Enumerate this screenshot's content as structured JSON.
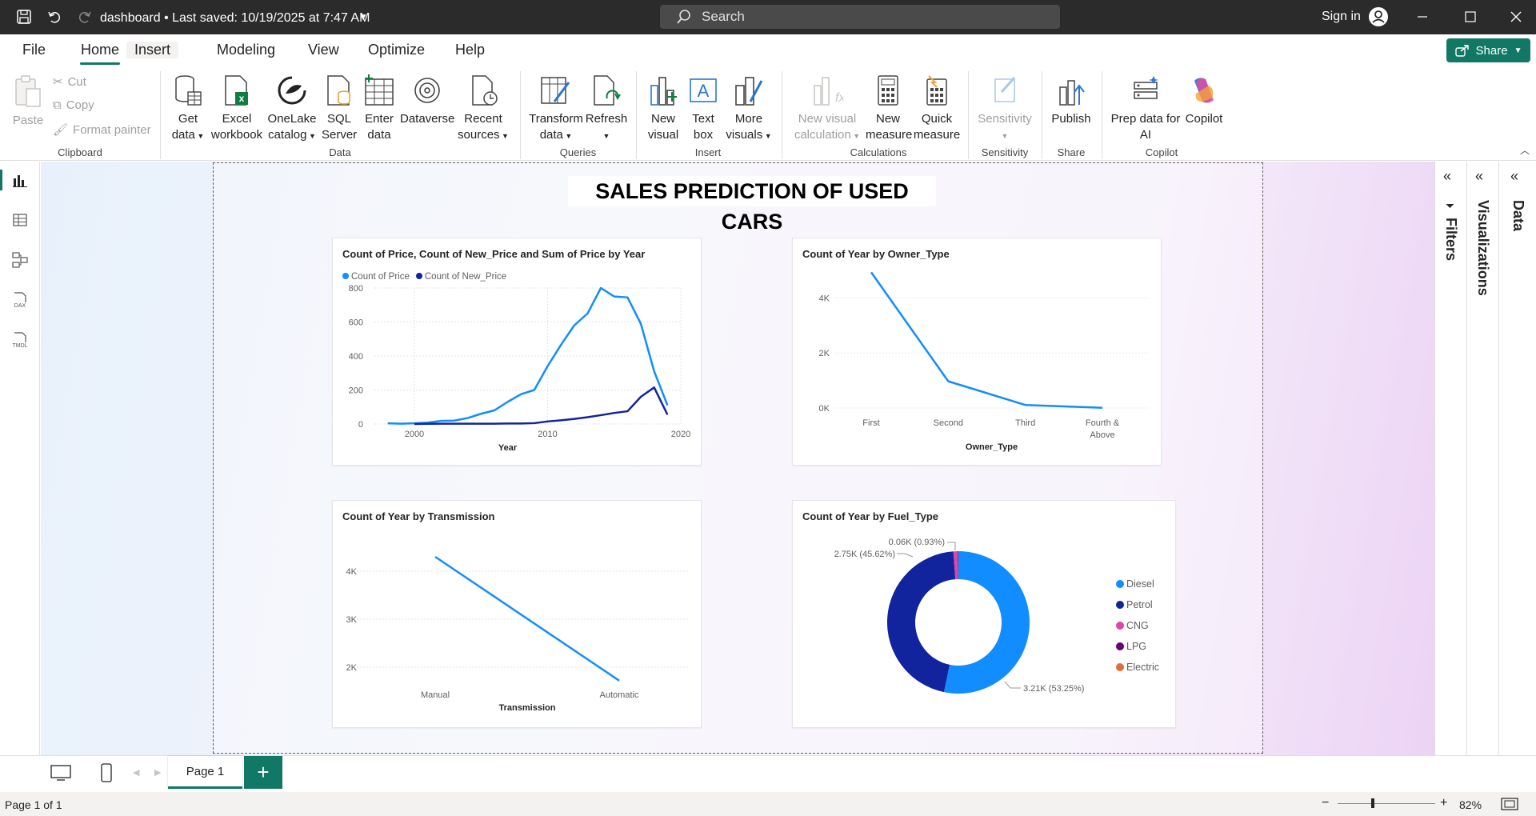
{
  "titlebar": {
    "title": "dashboard • Last saved: 10/19/2025 at 7:47 AM",
    "search_placeholder": "Search",
    "signin": "Sign in"
  },
  "menu": {
    "items": [
      "File",
      "Home",
      "Insert",
      "Modeling",
      "View",
      "Optimize",
      "Help"
    ],
    "active": "Home",
    "share": "Share"
  },
  "ribbon": {
    "clipboard": {
      "paste": "Paste",
      "cut": "Cut",
      "copy": "Copy",
      "format_painter": "Format painter",
      "label": "Clipboard"
    },
    "data": {
      "get_data": [
        "Get",
        "data"
      ],
      "excel": [
        "Excel",
        "workbook"
      ],
      "onelake": [
        "OneLake",
        "catalog"
      ],
      "sql": [
        "SQL",
        "Server"
      ],
      "enter": [
        "Enter",
        "data"
      ],
      "dataverse": [
        "Dataverse",
        ""
      ],
      "recent": [
        "Recent",
        "sources"
      ],
      "label": "Data"
    },
    "queries": {
      "transform": [
        "Transform",
        "data"
      ],
      "refresh": [
        "Refresh",
        ""
      ],
      "label": "Queries"
    },
    "insert": {
      "new_visual": [
        "New",
        "visual"
      ],
      "text_box": [
        "Text",
        "box"
      ],
      "more_visuals": [
        "More",
        "visuals"
      ],
      "label": "Insert"
    },
    "calculations": {
      "new_visual_calc": [
        "New visual",
        "calculation"
      ],
      "new_measure": [
        "New",
        "measure"
      ],
      "quick_measure": [
        "Quick",
        "measure"
      ],
      "label": "Calculations"
    },
    "sensitivity": {
      "btn": [
        "Sensitivity",
        ""
      ],
      "label": "Sensitivity"
    },
    "share": {
      "publish": [
        "Publish",
        ""
      ],
      "label": "Share"
    },
    "copilot": {
      "prep": [
        "Prep data for",
        "AI"
      ],
      "copilot": [
        "Copilot",
        ""
      ],
      "label": "Copilot"
    }
  },
  "report": {
    "title": "SALES PREDICTION OF USED CARS"
  },
  "side_panels": {
    "filters": "Filters",
    "visualizations": "Visualizations",
    "data": "Data"
  },
  "bottom": {
    "page_tab": "Page 1",
    "add": "+"
  },
  "status": {
    "page": "Page 1 of 1",
    "zoom": "82%"
  },
  "colors": {
    "accent": "#117865",
    "series_light": "#118DFF",
    "series_dark": "#12239E",
    "cng": "#E044A7",
    "lpg": "#6B007B",
    "electric": "#E66C37"
  },
  "chart_data": [
    {
      "type": "line",
      "title": "Count of Price, Count of New_Price and Sum of Price by Year",
      "xlabel": "Year",
      "ylabel": "",
      "x_ticks": [
        "2000",
        "2010",
        "2020"
      ],
      "y_ticks": [
        "0",
        "200",
        "400",
        "600",
        "800"
      ],
      "xlim": [
        1997,
        2020
      ],
      "ylim": [
        0,
        800
      ],
      "legend": "top-left",
      "series": [
        {
          "name": "Count of Price",
          "x": [
            1998,
            1999,
            2000,
            2001,
            2002,
            2003,
            2004,
            2005,
            2006,
            2007,
            2008,
            2009,
            2010,
            2011,
            2012,
            2013,
            2014,
            2015,
            2016,
            2017,
            2018,
            2019
          ],
          "values": [
            4,
            2,
            4,
            8,
            18,
            20,
            35,
            60,
            80,
            130,
            175,
            200,
            340,
            465,
            580,
            650,
            800,
            750,
            745,
            590,
            310,
            110
          ]
        },
        {
          "name": "Count of New_Price",
          "x": [
            2000,
            2001,
            2002,
            2003,
            2004,
            2005,
            2006,
            2007,
            2008,
            2009,
            2010,
            2011,
            2012,
            2013,
            2014,
            2015,
            2016,
            2017,
            2018,
            2019
          ],
          "values": [
            0,
            1,
            2,
            2,
            2,
            2,
            2,
            3,
            3,
            5,
            15,
            22,
            30,
            40,
            52,
            65,
            75,
            160,
            215,
            55
          ]
        }
      ]
    },
    {
      "type": "line",
      "title": "Count of Year by Owner_Type",
      "xlabel": "Owner_Type",
      "ylabel": "",
      "categories": [
        "First",
        "Second",
        "Third",
        "Fourth & Above"
      ],
      "y_ticks": [
        "0K",
        "2K",
        "4K"
      ],
      "ylim": [
        0,
        5000
      ],
      "series": [
        {
          "values": [
            4930,
            970,
            110,
            9
          ]
        }
      ]
    },
    {
      "type": "line",
      "title": "Count of Year by Transmission",
      "xlabel": "Transmission",
      "ylabel": "",
      "categories": [
        "Manual",
        "Automatic"
      ],
      "y_ticks": [
        "2K",
        "3K",
        "4K"
      ],
      "ylim": [
        1500,
        4600
      ],
      "series": [
        {
          "values": [
            4300,
            1720
          ]
        }
      ]
    },
    {
      "type": "pie",
      "title": "Count of Year by Fuel_Type",
      "categories": [
        "Diesel",
        "Petrol",
        "CNG",
        "LPG",
        "Electric"
      ],
      "values": [
        3210,
        2750,
        56,
        10,
        2
      ],
      "labels": [
        "3.21K (53.25%)",
        "2.75K (45.62%)",
        "0.06K (0.93%)"
      ],
      "legend": "right"
    }
  ]
}
